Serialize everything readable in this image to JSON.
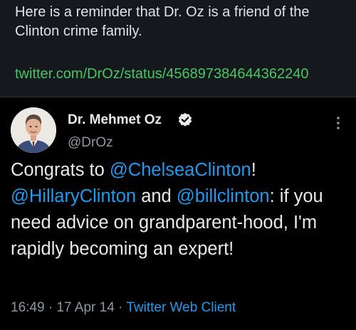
{
  "post": {
    "text": "Here is a reminder that Dr. Oz is a friend of the Clinton crime family.",
    "link": "twitter.com/DrOz/status/456897384644362240"
  },
  "tweet": {
    "display_name": "Dr. Mehmet Oz",
    "handle": "@DrOz",
    "body": {
      "t1": "Congrats to ",
      "m1": "@ChelseaClinton",
      "t2": "!",
      "m2": "@HillaryClinton",
      "t3": " and ",
      "m3": "@billclinton",
      "t4": ": if you need advice on grandparent-hood, I'm rapidly becoming an expert!"
    },
    "meta": {
      "time": "16:49",
      "sep1": " · ",
      "date": "17 Apr 14",
      "sep2": " · ",
      "client": "Twitter Web Client"
    }
  },
  "icons": {
    "avatar": "avatar-photo",
    "verified": "verified-badge-icon",
    "more": "more-options-icon"
  },
  "colors": {
    "page_bg": "#15181c",
    "card_bg": "#000000",
    "post_text": "#dfe3e6",
    "link_green": "#49c563",
    "mention_blue": "#1d9bf0",
    "muted_gray": "#8b98a5"
  }
}
